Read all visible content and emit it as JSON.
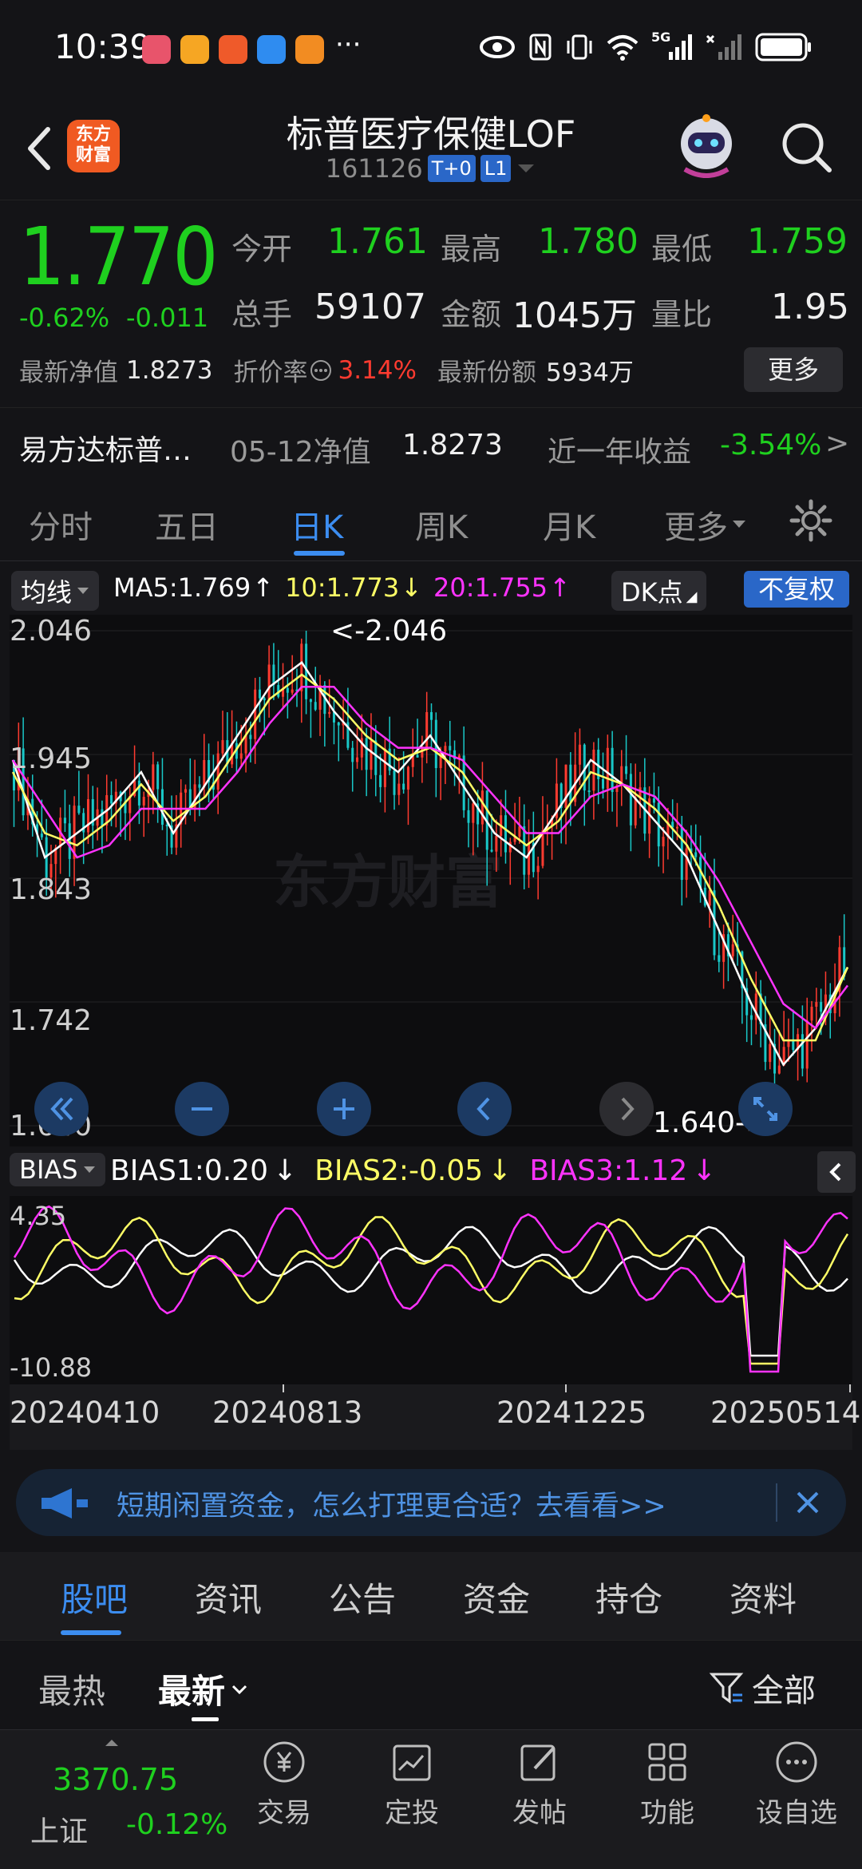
{
  "status_bar": {
    "time": "10:39",
    "more": "···",
    "net_label": "5G"
  },
  "header": {
    "title": "标普医疗保健LOF",
    "code": "161126",
    "tag1": "T+0",
    "tag2": "L1",
    "logo_line1": "东方",
    "logo_line2": "财富"
  },
  "quote": {
    "price": "1.770",
    "change_pct": "-0.62%",
    "change_val": "-0.011",
    "open_label": "今开",
    "open": "1.761",
    "high_label": "最高",
    "high": "1.780",
    "low_label": "最低",
    "low": "1.759",
    "vol_label": "总手",
    "vol": "59107",
    "amt_label": "金额",
    "amt": "1045万",
    "ratio_label": "量比",
    "ratio": "1.95",
    "nav_label": "最新净值",
    "nav": "1.8273",
    "discount_label": "折价率",
    "discount": "3.14%",
    "shares_label": "最新份额",
    "shares": "5934万",
    "more": "更多"
  },
  "tracking": {
    "name": "易方达标普…",
    "nav_date_label": "05-12净值",
    "nav": "1.8273",
    "yr_label": "近一年收益",
    "yr_return": "-3.54%",
    "arrow": ">"
  },
  "chart_tabs": [
    "分时",
    "五日",
    "日K",
    "周K",
    "月K",
    "更多"
  ],
  "chart_tabs_active": 2,
  "ma_row": {
    "selector": "均线",
    "ma5": "MA5:1.769",
    "ma10": "10:1.773",
    "ma20": "20:1.755",
    "dk": "DK点",
    "fq": "不复权"
  },
  "kline": {
    "y_labels": [
      "2.046",
      "1.945",
      "1.843",
      "1.742",
      "1.640"
    ],
    "max_label": "<-2.046",
    "min_label": "1.640->",
    "watermark": "东方财富"
  },
  "bias_row": {
    "selector": "BIAS",
    "b1": "BIAS1:0.20",
    "b2": "BIAS2:-0.05",
    "b3": "BIAS3:1.12",
    "y_top": "4.35",
    "y_bottom": "-10.88"
  },
  "dates": [
    "20240410",
    "20240813",
    "20241225",
    "20250514"
  ],
  "ad": {
    "text": "短期闲置资金，怎么打理更合适？去看看>>"
  },
  "bottom_tabs": [
    "股吧",
    "资讯",
    "公告",
    "资金",
    "持仓",
    "资料"
  ],
  "bottom_tabs_active": 0,
  "sub_tabs": {
    "hot": "最热",
    "latest": "最新",
    "filter": "全部"
  },
  "footer": {
    "index_value": "3370.75",
    "index_name": "上证",
    "index_change": "-0.12%",
    "buttons": [
      "交易",
      "定投",
      "发帖",
      "功能",
      "设自选"
    ]
  },
  "colors": {
    "up": "#ff3b30",
    "down": "#1fd01f",
    "accent": "#3c8df0",
    "ma5": "#ffffff",
    "ma10": "#ffff66",
    "ma20": "#ff33ff"
  },
  "chart_data": {
    "type": "line",
    "title": "",
    "ylim": [
      1.64,
      2.046
    ],
    "x": [
      "20240410",
      "20240813",
      "20241225",
      "20250514"
    ],
    "series": [
      {
        "name": "MA5",
        "values": [
          1.94,
          1.86,
          1.88,
          1.9,
          1.93,
          1.88,
          1.92,
          1.96,
          2.0,
          2.02,
          1.98,
          1.95,
          1.93,
          1.96,
          1.92,
          1.88,
          1.86,
          1.9,
          1.94,
          1.92,
          1.89,
          1.86,
          1.8,
          1.74,
          1.69,
          1.72,
          1.77
        ]
      },
      {
        "name": "10",
        "values": [
          1.93,
          1.88,
          1.87,
          1.89,
          1.92,
          1.89,
          1.91,
          1.95,
          1.99,
          2.01,
          1.99,
          1.96,
          1.94,
          1.95,
          1.93,
          1.89,
          1.87,
          1.89,
          1.93,
          1.92,
          1.9,
          1.87,
          1.82,
          1.76,
          1.71,
          1.71,
          1.77
        ]
      },
      {
        "name": "20",
        "values": [
          1.94,
          1.9,
          1.86,
          1.87,
          1.9,
          1.9,
          1.9,
          1.93,
          1.97,
          2.0,
          2.0,
          1.97,
          1.95,
          1.95,
          1.94,
          1.91,
          1.88,
          1.88,
          1.91,
          1.92,
          1.91,
          1.88,
          1.84,
          1.79,
          1.74,
          1.72,
          1.755
        ]
      }
    ]
  }
}
